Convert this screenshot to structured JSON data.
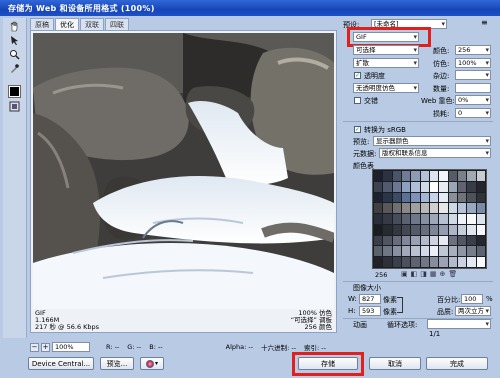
{
  "window": {
    "title": "存储为 Web 和设备所用格式 (100%)"
  },
  "tools": [
    {
      "name": "hand-tool-icon",
      "glyph": "✋"
    },
    {
      "name": "slice-select-tool-icon",
      "glyph": "↖"
    },
    {
      "name": "zoom-tool-icon",
      "glyph": "🔍"
    },
    {
      "name": "eyedropper-tool-icon",
      "glyph": "⁄"
    },
    {
      "name": "preview-toggle-icon",
      "glyph": "▣"
    }
  ],
  "tabs": [
    {
      "label": "原稿",
      "active": false
    },
    {
      "label": "优化",
      "active": true
    },
    {
      "label": "双联",
      "active": false
    },
    {
      "label": "四联",
      "active": false
    }
  ],
  "image_info": {
    "format": "GIF",
    "size": "1.166M",
    "time": "217 秒 @ 56.6 Kbps",
    "dither": "100% 仿色",
    "palette": "“可选择” 调板",
    "colors": "256 颜色"
  },
  "status": {
    "zoom": "100%",
    "r": "R: --",
    "g": "G: --",
    "b": "B: --",
    "alpha": "Alpha: --",
    "hex": "十六进制: --",
    "index": "索引: --"
  },
  "buttons": {
    "device_central": "Device Central...",
    "preview": "预览...",
    "save": "存储",
    "cancel": "取消",
    "done": "完成"
  },
  "settings": {
    "preset_label": "预设:",
    "preset_value": "[未命名]",
    "format_value": "GIF",
    "reduction_value": "可选择",
    "colors_label": "颜色:",
    "colors_value": "256",
    "dither_algo_value": "扩散",
    "dither_label": "仿色:",
    "dither_value": "100%",
    "transparency_label": "透明度",
    "transparency_checked": true,
    "matte_label": "杂边:",
    "trans_dither_value": "无透明度仿色",
    "amount_label": "数量:",
    "interlaced_label": "交错",
    "interlaced_checked": false,
    "websnap_label": "Web 靠色:",
    "websnap_value": "0%",
    "lossy_label": "损耗:",
    "lossy_value": "0",
    "convert_srgb_label": "转换为 sRGB",
    "convert_srgb_checked": true,
    "preview_label": "预览:",
    "preview_value": "显示器颜色",
    "metadata_label": "元数据:",
    "metadata_value": "版权和联系信息",
    "color_table_label": "颜色表",
    "color_count": "256"
  },
  "image_size": {
    "section_label": "图像大小",
    "w_label": "W:",
    "w_value": "827",
    "w_unit": "像素",
    "h_label": "H:",
    "h_value": "593",
    "h_unit": "像素",
    "percent_label": "百分比:",
    "percent_value": "100",
    "percent_unit": "%",
    "quality_label": "品质:",
    "quality_value": "两次立方"
  },
  "animation": {
    "section_label": "动画",
    "loop_label": "循环选项:",
    "frame_counter": "1/1"
  },
  "colors": {
    "accent": "#e0201c",
    "titlebar": "#1845b8",
    "panel": "#b9cbe4"
  },
  "palette": [
    "#1e1f2c",
    "#2c3144",
    "#4a5468",
    "#6f7c95",
    "#8d9bb4",
    "#b4c2d8",
    "#dce4ee",
    "#f2f5f9",
    "#555c66",
    "#7a8088",
    "#a3a9b3",
    "#c8ccd3",
    "#3d4250",
    "#525a70",
    "#6c7791",
    "#8ea0bd",
    "#b0bfd6",
    "#d0dae8",
    "#ffffff",
    "#e8ecf2",
    "#9aa5b6",
    "#5f6470",
    "#383c46",
    "#23262e",
    "#1b2230",
    "#293548",
    "#3b4b66",
    "#5b7096",
    "#7e93b9",
    "#a3b6d6",
    "#c6d3e8",
    "#e4ebf4",
    "#8a8f99",
    "#6e737c",
    "#4d525b",
    "#2f333a",
    "#404040",
    "#585858",
    "#707070",
    "#888888",
    "#a0a0a0",
    "#b8b8b8",
    "#d0d0d0",
    "#e8e8e8",
    "#cfd8e6",
    "#b6c3d7",
    "#98a8c1",
    "#7a8ba6",
    "#2a2e38",
    "#353a46",
    "#464c5a",
    "#5a6272",
    "#6f788a",
    "#8690a3",
    "#9ea8bb",
    "#b8c1d2",
    "#d2d9e6",
    "#eef1f7",
    "#f8f9fb",
    "#dde3ec",
    "#1a1c20",
    "#262a31",
    "#323740",
    "#424854",
    "#535a68",
    "#676f7f",
    "#7d8697",
    "#949db0",
    "#adb5c6",
    "#c6cddb",
    "#e0e5ee",
    "#f5f7fa",
    "#3a3f4a",
    "#4f5563",
    "#666d7d",
    "#7f8798",
    "#99a1b2",
    "#b3bacb",
    "#cdd3e1",
    "#e6eaf2",
    "#6a7180",
    "#515763",
    "#393e48",
    "#24272e",
    "#59606e",
    "#6f7787",
    "#8890a1",
    "#a1a9ba",
    "#bac1d1",
    "#d3d9e6",
    "#ecf0f6",
    "#c0c7d4",
    "#a7aebd",
    "#8e95a4",
    "#767d8b",
    "#5e6472",
    "#202228",
    "#2d3038",
    "#3b3f49",
    "#4b505c",
    "#5d6370",
    "#717786",
    "#868d9d",
    "#9ca3b4",
    "#b3bacb",
    "#cbd1e0",
    "#e3e8f1",
    "#fafbfd"
  ]
}
